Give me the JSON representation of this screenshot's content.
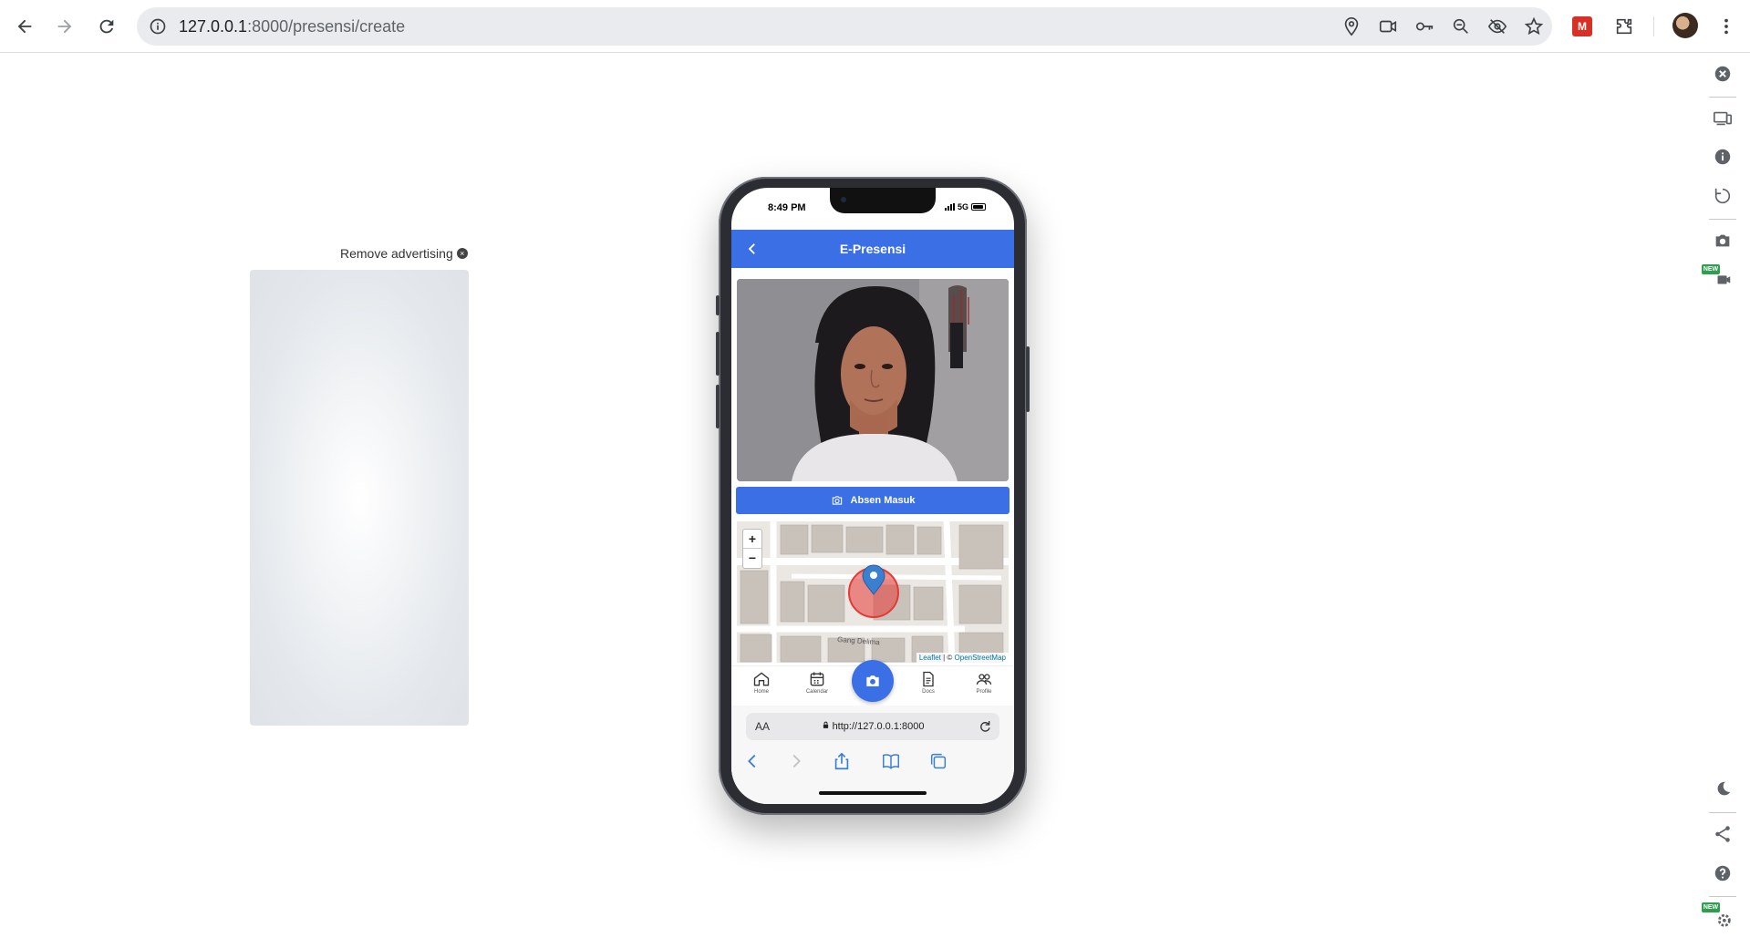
{
  "browser": {
    "url_host": "127.0.0.1",
    "url_path": ":8000/presensi/create",
    "icons": [
      "back-icon",
      "forward-icon",
      "reload-icon",
      "site-info-icon",
      "location-icon",
      "camera-icon",
      "password-key-icon",
      "zoom-icon",
      "eye-off-icon",
      "star-icon",
      "extension-red-icon",
      "puzzle-icon",
      "profile-avatar",
      "kebab-menu-icon"
    ]
  },
  "side_toolbar": {
    "new_badge": "NEW",
    "icons": [
      "close-icon",
      "devices-icon",
      "info-icon",
      "rotate-icon",
      "screenshot-icon",
      "record-video-icon",
      "dark-mode-icon",
      "share-icon",
      "help-icon",
      "settings-icon"
    ]
  },
  "ad": {
    "remove_label": "Remove advertising",
    "close_glyph": "×"
  },
  "phone": {
    "status": {
      "time": "8:49 PM",
      "network": "5G"
    },
    "header": {
      "title": "E-Presensi"
    },
    "absen_button": {
      "label": "Absen Masuk"
    },
    "map": {
      "zoom_in": "+",
      "zoom_out": "−",
      "street_label": "Gang Delima",
      "attribution_leaflet": "Leaflet",
      "attribution_sep": " | © ",
      "attribution_osm": "OpenStreetMap"
    },
    "bottom_nav": {
      "items": [
        {
          "label": "Home"
        },
        {
          "label": "Calendar"
        },
        {
          "label": "Docs"
        },
        {
          "label": "Profile"
        }
      ]
    },
    "safari": {
      "aa": "AA",
      "address": "http://127.0.0.1:8000"
    }
  },
  "colors": {
    "primary": "#3a6fe6",
    "marker": "#3a7fd0",
    "circle": "#e53935"
  }
}
